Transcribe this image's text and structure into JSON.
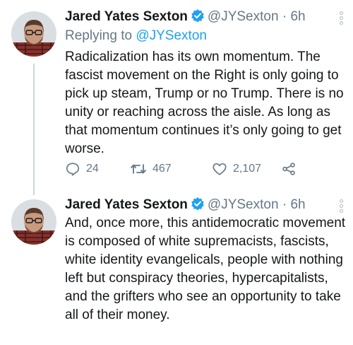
{
  "tweet1": {
    "name": "Jared Yates Sexton",
    "handle": "@JYSexton",
    "separator": "·",
    "time": "6h",
    "reply_prefix": "Replying to",
    "reply_handle": "@JYSexton",
    "text": "Radicalization has its own momentum. The fascist movement on the Right is only going to pick up steam, Trump or no Trump. There is no unity or reaching across the aisle. As long as that momentum continues it’s only going to get worse.",
    "replies": "24",
    "retweets": "467",
    "likes": "2,107"
  },
  "tweet2": {
    "name": "Jared Yates Sexton",
    "handle": "@JYSexton",
    "separator": "·",
    "time": "6h",
    "text": "And, once more, this antidemocratic movement is composed of white supremacists, fascists, white identity evangelicals, people with nothing left but conspiracy theories, hypercapitalists, and the grifters who see an opportunity to take all of their money."
  },
  "colors": {
    "accent": "#1da1f2",
    "secondary": "#657786",
    "text": "#14171a"
  },
  "icons": [
    "verified-badge-icon",
    "more-options-icon",
    "reply-icon",
    "retweet-icon",
    "like-icon",
    "share-icon"
  ]
}
